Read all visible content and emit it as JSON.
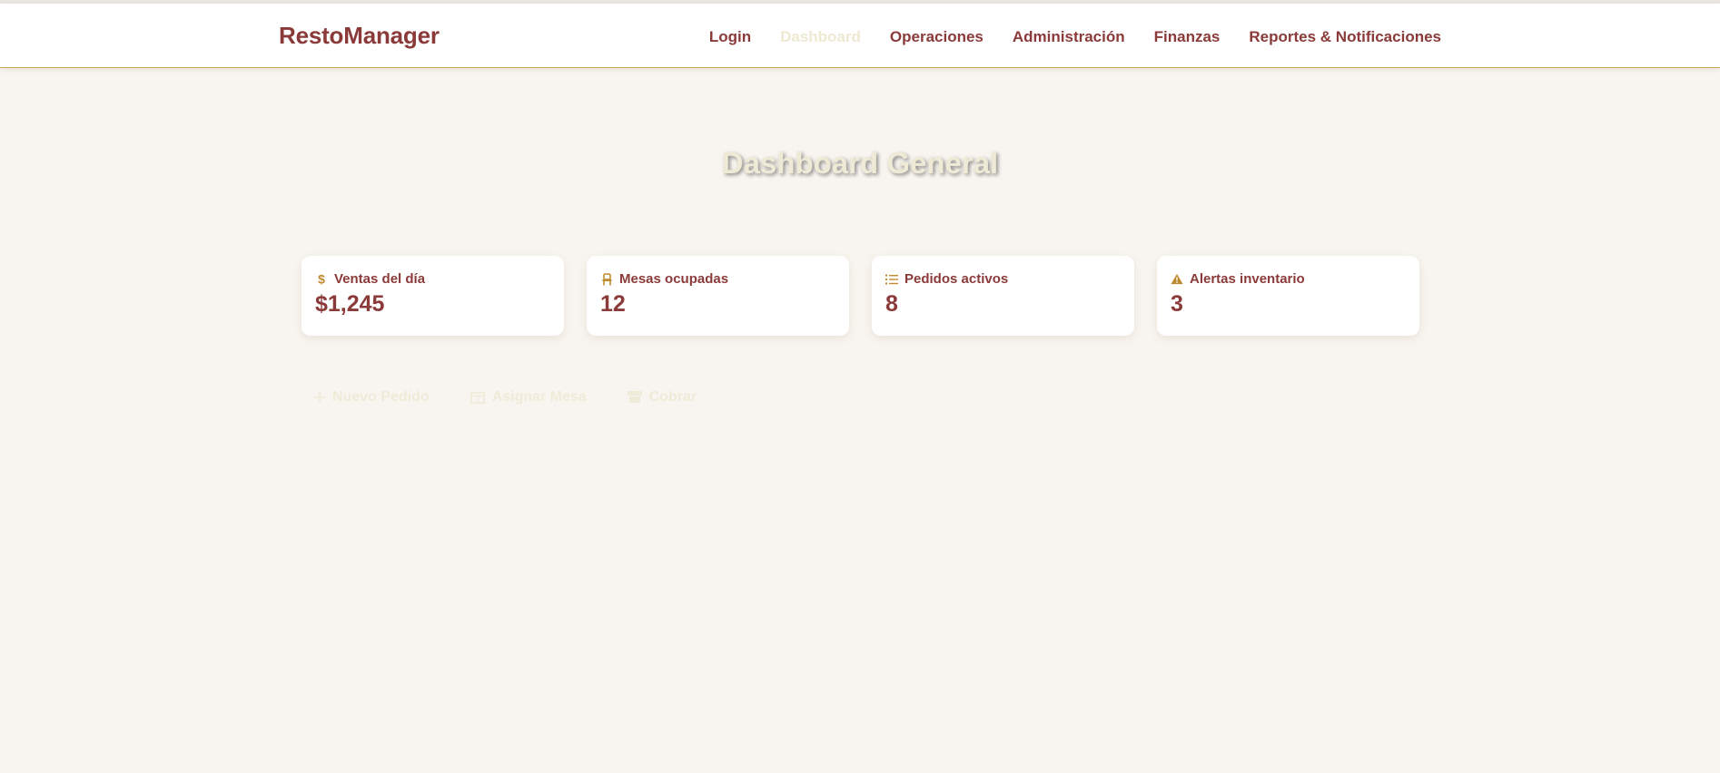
{
  "brand": "RestoManager",
  "nav": {
    "items": [
      {
        "label": "Login"
      },
      {
        "label": "Dashboard",
        "active": true
      },
      {
        "label": "Operaciones"
      },
      {
        "label": "Administración"
      },
      {
        "label": "Finanzas"
      },
      {
        "label": "Reportes & Notificaciones"
      }
    ]
  },
  "page": {
    "title": "Dashboard General"
  },
  "stats": [
    {
      "label": "Ventas del día",
      "value": "$1,245",
      "icon": "dollar-icon"
    },
    {
      "label": "Mesas ocupadas",
      "value": "12",
      "icon": "chair-icon"
    },
    {
      "label": "Pedidos activos",
      "value": "8",
      "icon": "list-icon"
    },
    {
      "label": "Alertas inventario",
      "value": "3",
      "icon": "warning-icon"
    }
  ],
  "actions": [
    {
      "label": "Nuevo Pedido",
      "icon": "plus-icon"
    },
    {
      "label": "Asignar Mesa",
      "icon": "table-icon"
    },
    {
      "label": "Cobrar",
      "icon": "register-icon"
    }
  ],
  "colors": {
    "primary": "#8b3a3a",
    "accent": "#c08a2e",
    "background": "#f8f5f0",
    "faded": "#efebd9"
  }
}
